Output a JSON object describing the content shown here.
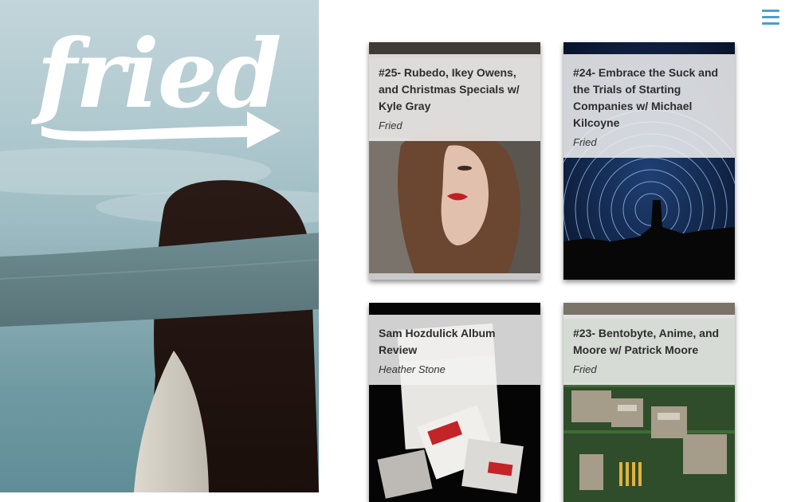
{
  "site": {
    "logo_text": "fried"
  },
  "menu": {
    "icon": "hamburger-menu-icon",
    "accent": "#4d9fd0"
  },
  "cards": [
    {
      "title": "#25- Rubedo, Ikey Owens, and Christmas Specials w/ Kyle Gray",
      "author": "Fried",
      "image": "woman-red-lips-portrait"
    },
    {
      "title": "#24- Embrace the Suck and the Trials of Starting Companies w/ Michael Kilcoyne",
      "author": "Fried",
      "image": "star-trails-night-sky"
    },
    {
      "title": "Sam Hozdulick Album Review",
      "author": "Heather Stone",
      "image": "marlboro-cigarette-packs"
    },
    {
      "title": "#23- Bentobyte, Anime, and Moore w/ Patrick Moore",
      "author": "Fried",
      "image": "circuit-board-closeup"
    }
  ]
}
